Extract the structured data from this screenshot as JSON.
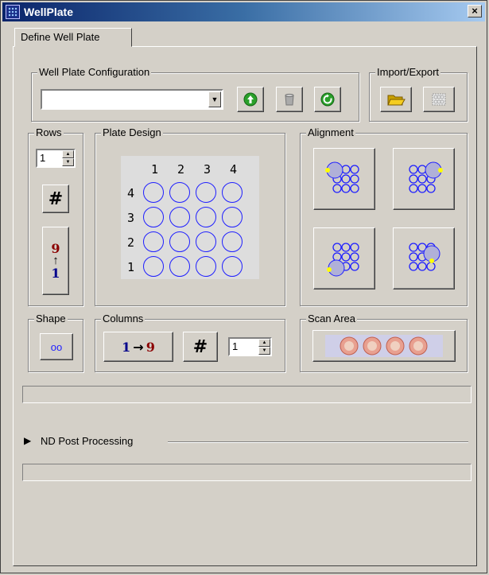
{
  "window": {
    "title": "WellPlate",
    "close_label": "×"
  },
  "tabs": [
    {
      "label": "Define Well Plate"
    }
  ],
  "config_group": {
    "label": "Well Plate Configuration",
    "selected_value": ""
  },
  "import_export": {
    "label": "Import/Export"
  },
  "rows": {
    "label": "Rows",
    "value": "1",
    "hash_label": "#",
    "order_top": "9",
    "order_bottom": "1"
  },
  "plate_design": {
    "label": "Plate Design",
    "column_headers": [
      "1",
      "2",
      "3",
      "4"
    ],
    "row_headers": [
      "4",
      "3",
      "2",
      "1"
    ]
  },
  "alignment": {
    "label": "Alignment"
  },
  "shape": {
    "label": "Shape",
    "symbol": "oo"
  },
  "columns": {
    "label": "Columns",
    "order_start": "1",
    "order_end": "9",
    "hash_label": "#",
    "value": "1"
  },
  "scan_area": {
    "label": "Scan Area"
  },
  "post_processing": {
    "label": "ND Post Processing"
  },
  "colors": {
    "well_stroke": "#1f1fff",
    "accent_red": "#8b0000",
    "accent_blue": "#00008b",
    "alignment_marker": "#ffff00"
  }
}
